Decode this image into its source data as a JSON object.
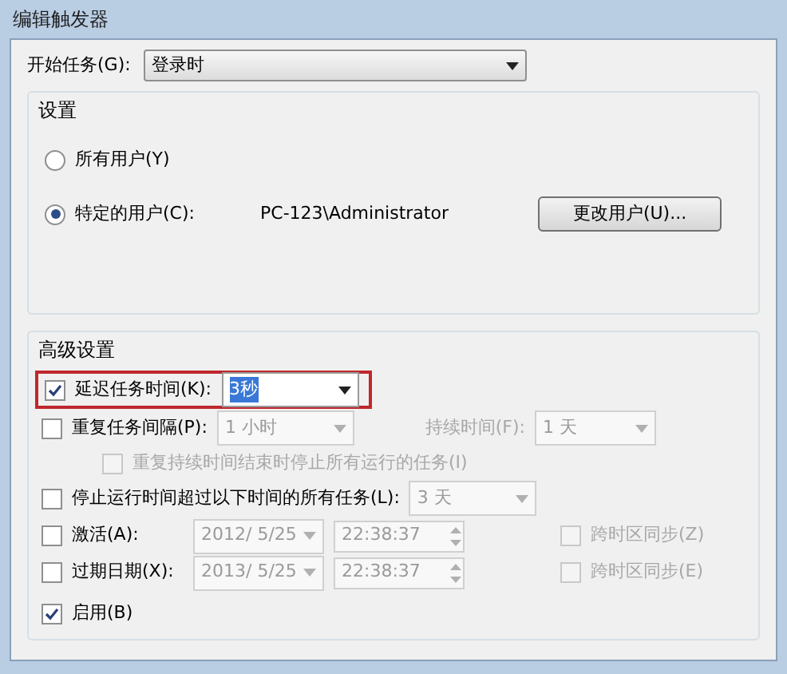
{
  "window": {
    "title": "编辑触发器"
  },
  "start_task": {
    "label": "开始任务(G):",
    "value": "登录时"
  },
  "settings": {
    "title": "设置",
    "radios": [
      {
        "label": "所有用户(Y)",
        "selected": false
      },
      {
        "label": "特定的用户(C):",
        "selected": true,
        "user": "PC-123\\Administrator"
      }
    ],
    "change_user_button": "更改用户(U)..."
  },
  "advanced": {
    "title": "高级设置",
    "rows": [
      {
        "kind": "select",
        "label": "延迟任务时间(K):",
        "checked": true,
        "highlighted": true,
        "value": "3秒",
        "disabled": false
      },
      {
        "kind": "select2",
        "label": "重复任务间隔(P):",
        "checked": false,
        "value": "1 小时",
        "disabled": true,
        "label2": "持续时间(F):",
        "value2": "1 天"
      },
      {
        "kind": "sub",
        "label": "重复持续时间结束时停止所有运行的任务(I)",
        "checked": false,
        "disabled": true
      },
      {
        "kind": "select",
        "label": "停止运行时间超过以下时间的所有任务(L):",
        "checked": false,
        "value": "3 天",
        "disabled": true
      },
      {
        "kind": "date",
        "label": "激活(A):",
        "checked": false,
        "date": "2012/  5/25",
        "time": "22:38:37",
        "disabled": true,
        "sync": "跨时区同步(Z)",
        "sync_checked": false
      },
      {
        "kind": "date",
        "label": "过期日期(X):",
        "checked": false,
        "date": "2013/  5/25",
        "time": "22:38:37",
        "disabled": true,
        "sync": "跨时区同步(E)",
        "sync_checked": false
      },
      {
        "kind": "plain",
        "label": "启用(B)",
        "checked": true
      }
    ]
  }
}
